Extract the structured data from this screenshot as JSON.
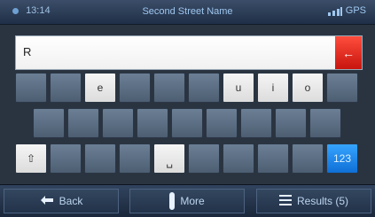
{
  "status": {
    "time": "13:14",
    "title": "Second Street Name",
    "signal": "GPS"
  },
  "input": {
    "value": "R"
  },
  "keyboard": {
    "row1": [
      "",
      "",
      "e",
      "",
      "",
      "",
      "u",
      "i",
      "o",
      ""
    ],
    "row2": [
      "",
      "",
      "",
      "",
      "",
      "",
      "",
      "",
      ""
    ],
    "row3_mid": [
      "",
      "",
      "",
      "",
      "",
      "",
      "",
      "",
      ""
    ],
    "shift": "⇧",
    "space": "␣",
    "mode": "123"
  },
  "bottom": {
    "back_label": "Back",
    "more_label": "More",
    "results_label": "Results (5)"
  },
  "colors": {
    "accent_blue": "#1c86ff",
    "delete_red": "#e4281d"
  }
}
